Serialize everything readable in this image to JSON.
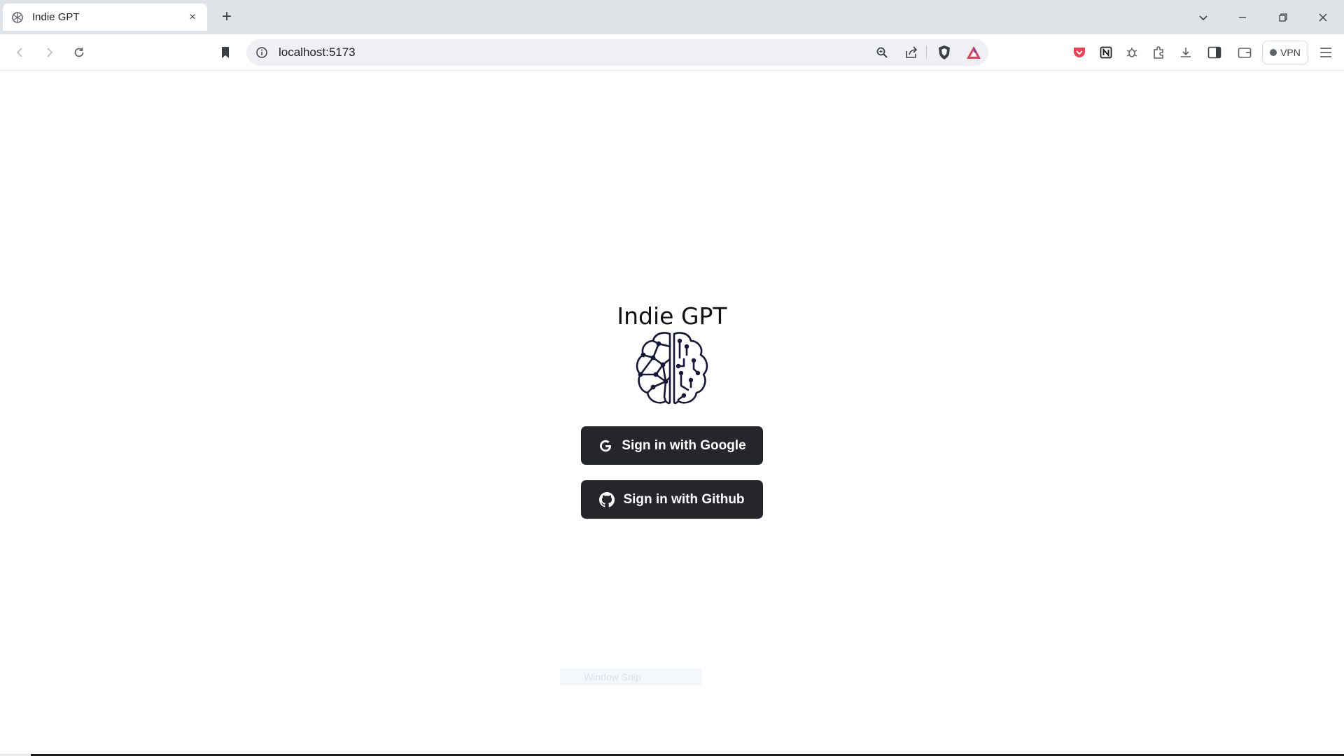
{
  "browser": {
    "tab": {
      "title": "Indie GPT",
      "favicon": "brain-favicon-icon",
      "close": "×"
    },
    "new_tab": "+",
    "url": "localhost:5173",
    "vpn_label": "VPN"
  },
  "page": {
    "title": "Indie GPT",
    "logo": "brain-circuit-logo",
    "buttons": {
      "google_label": "Sign in with Google",
      "github_label": "Sign in with Github"
    },
    "overlay_label": "Window Snip"
  },
  "colors": {
    "button_bg": "#24262b",
    "button_text": "#ffffff",
    "logo_stroke": "#16163a",
    "brave_shield": "#3c4043",
    "triangle_accent": "#e23e57",
    "pocket_red": "#ef4056"
  }
}
